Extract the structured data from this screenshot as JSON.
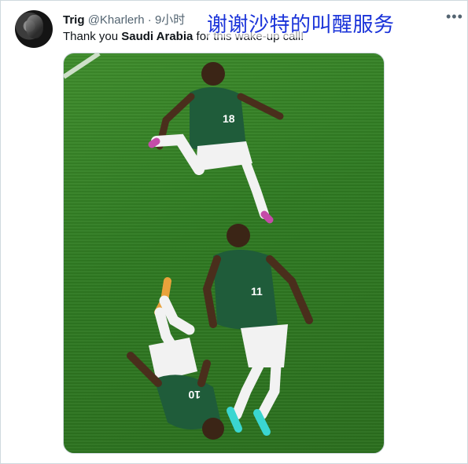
{
  "tweet": {
    "display_name": "Trig",
    "handle": "@Kharlerh",
    "separator": "·",
    "time": "9小时",
    "text_before": "Thank you ",
    "text_bold": "Saudi Arabia",
    "text_after": " for this wake-up call!"
  },
  "overlay_caption": "谢谢沙特的叫醒服务",
  "more_menu": "•••",
  "media": {
    "jersey_numbers": [
      "18",
      "11",
      "10"
    ]
  },
  "colors": {
    "overlay_text": "#1a33d9",
    "pitch": "#2f7a22",
    "jersey": "#1f5c3a"
  }
}
